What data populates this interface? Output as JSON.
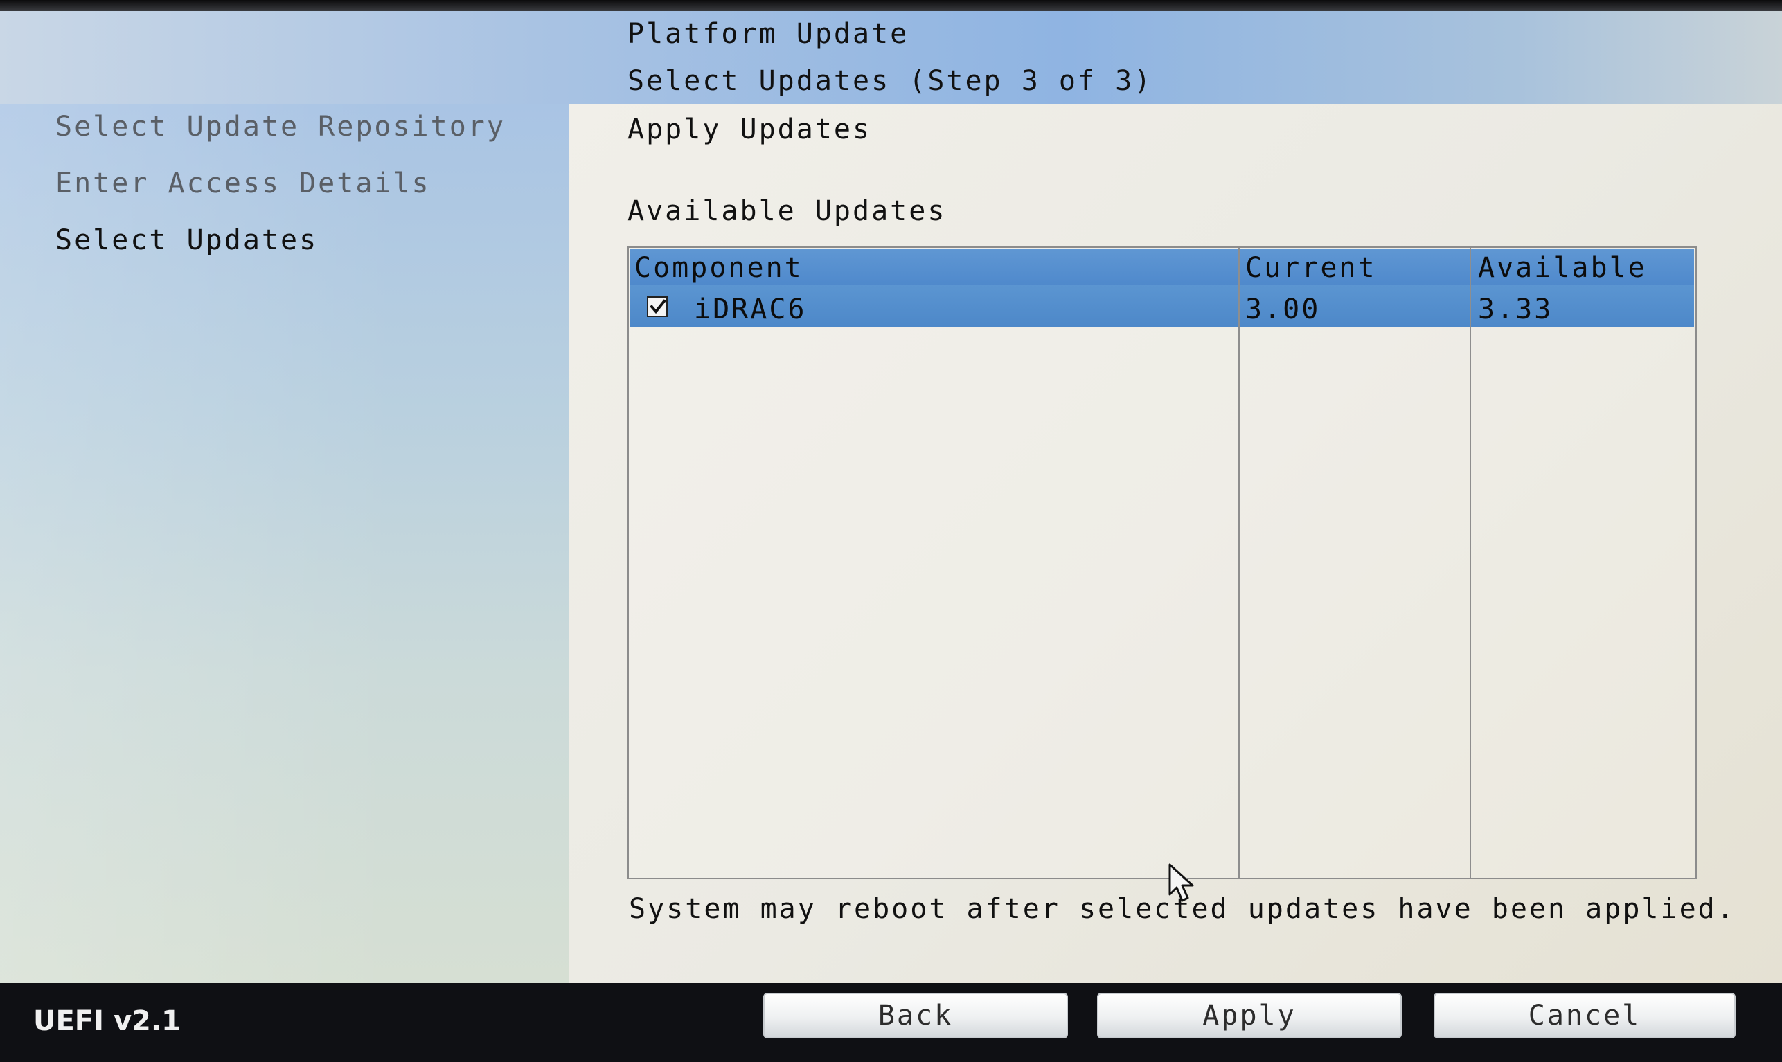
{
  "header": {
    "title": "Platform Update",
    "subtitle": "Select Updates (Step 3 of 3)"
  },
  "sidebar": {
    "items": [
      {
        "label": "Select Update Repository",
        "state": "completed"
      },
      {
        "label": "Enter Access Details",
        "state": "completed"
      },
      {
        "label": "Select Updates",
        "state": "current"
      }
    ]
  },
  "main": {
    "section_title": "Apply Updates",
    "table_title": "Available Updates",
    "table": {
      "columns": [
        "Component",
        "Current",
        "Available"
      ],
      "rows": [
        {
          "selected": true,
          "component": "iDRAC6",
          "current": "3.00",
          "available": "3.33"
        }
      ]
    },
    "note": "System may reboot after selected updates have been applied."
  },
  "footer": {
    "version": "UEFI v2.1",
    "back_label": "Back",
    "apply_label": "Apply",
    "cancel_label": "Cancel"
  },
  "colors": {
    "selection": "#5b95d1",
    "header_gradient": "#8fb4e2",
    "footer_bg": "#0f1014"
  },
  "icons": {
    "checkbox": "checkbox-checked-icon",
    "cursor": "mouse-pointer-icon"
  }
}
